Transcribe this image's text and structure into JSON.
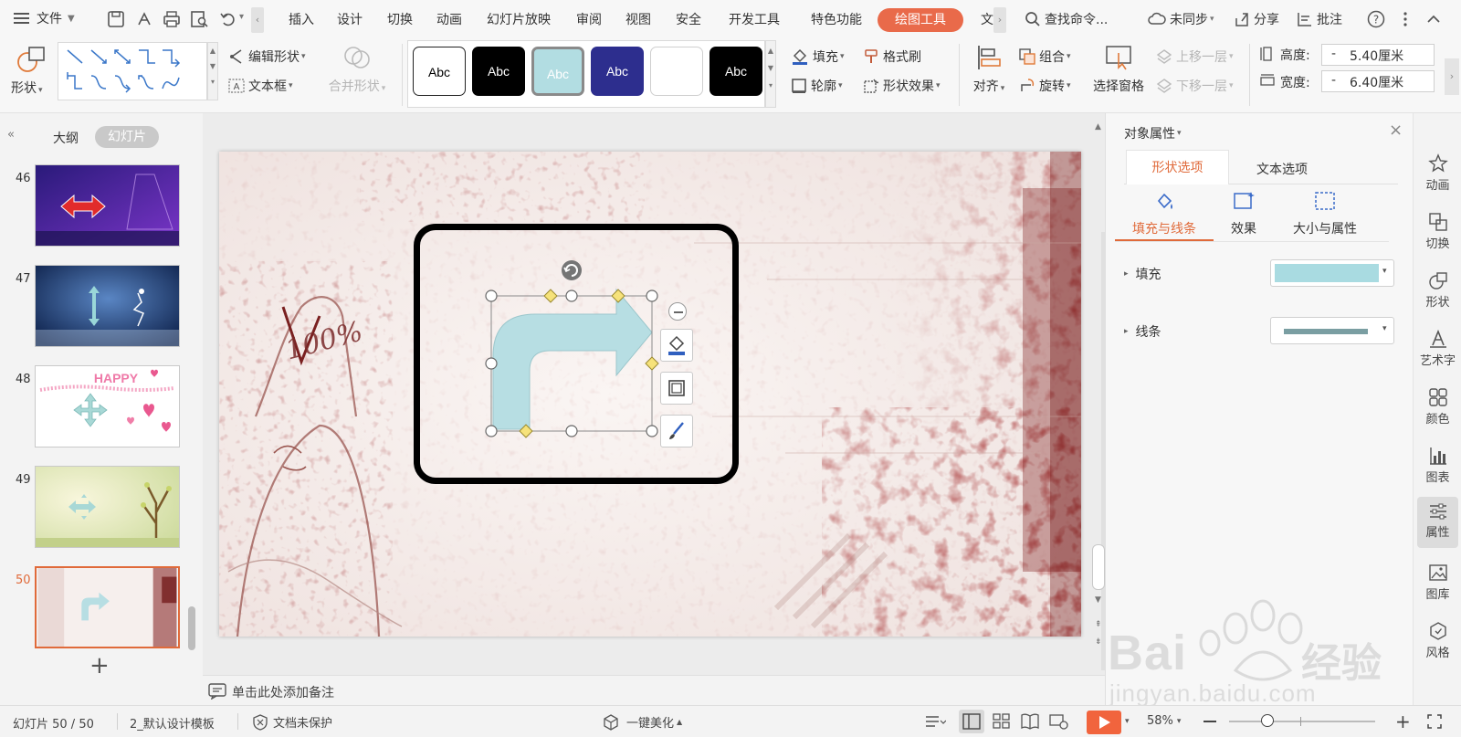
{
  "menubar": {
    "file_label": "文件",
    "tabs": [
      "插入",
      "设计",
      "切换",
      "动画",
      "幻灯片放映",
      "审阅",
      "视图",
      "安全",
      "开发工具",
      "特色功能"
    ],
    "active_tab": "绘图工具",
    "overflow_tab": "文",
    "search_placeholder": "查找命令...",
    "sync_label": "未同步",
    "share_label": "分享",
    "review_label": "批注"
  },
  "ribbon": {
    "shape_label": "形状",
    "edit_shape": "编辑形状",
    "text_box": "文本框",
    "merge_shape": "合并形状",
    "style_samples": [
      "Abc",
      "Abc",
      "Abc",
      "Abc",
      "",
      "Abc"
    ],
    "fill": "填充",
    "format_painter": "格式刷",
    "outline": "轮廓",
    "shape_effects": "形状效果",
    "align": "对齐",
    "group": "组合",
    "rotate": "旋转",
    "selection_pane": "选择窗格",
    "bring_forward": "上移一层",
    "send_backward": "下移一层",
    "height_label": "高度:",
    "height_value": "5.40厘米",
    "width_label": "宽度:",
    "width_value": "6.40厘米",
    "minus": "-"
  },
  "leftpanel": {
    "tab_outline": "大纲",
    "tab_slides": "幻灯片",
    "slides": [
      {
        "num": "46"
      },
      {
        "num": "47"
      },
      {
        "num": "48",
        "text": "HAPPY"
      },
      {
        "num": "49"
      },
      {
        "num": "50"
      }
    ],
    "add_slide": "+"
  },
  "slide": {
    "handwritten": "100%"
  },
  "notes": {
    "placeholder": "单击此处添加备注"
  },
  "rightpanel": {
    "title": "对象属性",
    "tab_shape": "形状选项",
    "tab_text": "文本选项",
    "sub_fill_line": "填充与线条",
    "sub_effect": "效果",
    "sub_size": "大小与属性",
    "fill_label": "填充",
    "line_label": "线条",
    "fill_color": "#a9dbe1",
    "line_color": "#7a9ea2"
  },
  "rightstrip": {
    "items": [
      "动画",
      "切换",
      "形状",
      "艺术字",
      "颜色",
      "图表",
      "属性",
      "图库",
      "风格"
    ]
  },
  "statusbar": {
    "slide_count": "幻灯片 50 / 50",
    "template": "2_默认设计模板",
    "doc_protect": "文档未保护",
    "beautify": "一键美化",
    "zoom": "58%"
  },
  "colors": {
    "accent": "#e96a4a",
    "arrow_fill": "#b7dee3",
    "play_button": "#f1643d"
  },
  "watermark": {
    "brand": "Bai",
    "brand_cn": "经验",
    "url": "jingyan.baidu.com"
  }
}
